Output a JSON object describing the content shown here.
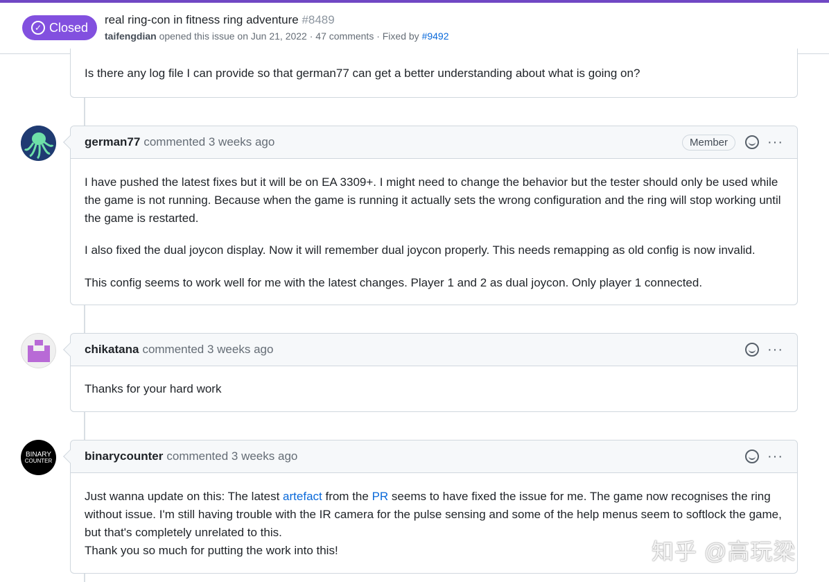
{
  "issue": {
    "status": "Closed",
    "title": "real ring-con in fitness ring adventure",
    "number": "#8489",
    "author": "taifengdian",
    "opened_text": "opened this issue on Jun 21, 2022 · 47 comments · Fixed by",
    "fixed_by": "#9492"
  },
  "colors": {
    "closed": "#8250df",
    "link": "#0969da"
  },
  "comments": [
    {
      "body": [
        "Is there any log file I can provide so that german77 can get a better understanding about what is going on?"
      ]
    },
    {
      "author": "german77",
      "action": "commented 3 weeks ago",
      "badge": "Member",
      "body": [
        "I have pushed the latest fixes but it will be on EA 3309+. I might need to change the behavior but the tester should only be used while the game is not running. Because when the game is running it actually sets the wrong configuration and the ring will stop working until the game is restarted.",
        "I also fixed the dual joycon display. Now it will remember dual joycon properly. This needs remapping as old config is now invalid.",
        "This config seems to work well for me with the latest changes. Player 1 and 2 as dual joycon. Only player 1 connected."
      ]
    },
    {
      "author": "chikatana",
      "action": "commented 3 weeks ago",
      "body": [
        "Thanks for your hard work"
      ]
    },
    {
      "author": "binarycounter",
      "action": "commented 3 weeks ago",
      "avatar_text": [
        "BINARY",
        "COUNTER"
      ],
      "body_parts": {
        "a": "Just wanna update on this: The latest ",
        "link1": "artefact",
        "b": " from the ",
        "link2": "PR",
        "c": " seems to have fixed the issue for me. The game now recognises the ring without issue. I'm still having trouble with the IR camera for the pulse sensing and some of the help menus seem to softlock the game, but that's completely unrelated to this.",
        "d": "Thank you so much for putting the work into this!"
      }
    }
  ],
  "watermark": "知乎 @高玩梁"
}
